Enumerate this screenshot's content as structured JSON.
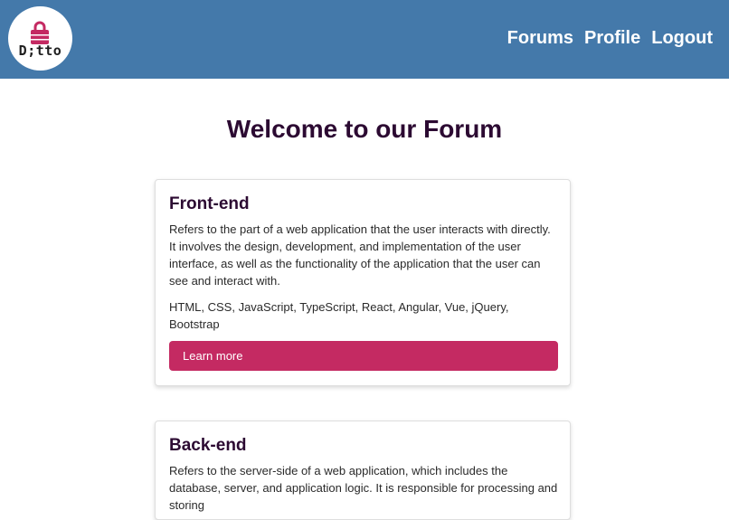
{
  "header": {
    "logo_text": "D;tto",
    "nav": [
      {
        "label": "Forums"
      },
      {
        "label": "Profile"
      },
      {
        "label": "Logout"
      }
    ],
    "colors": {
      "bar": "#4479aa",
      "logo_lock": "#c42a62"
    }
  },
  "main": {
    "title": "Welcome to our Forum",
    "cards": [
      {
        "title": "Front-end",
        "description": "Refers to the part of a web application that the user interacts with directly. It involves the design, development, and implementation of the user interface, as well as the functionality of the application that the user can see and interact with.",
        "technologies": "HTML, CSS, JavaScript, TypeScript, React, Angular, Vue, jQuery, Bootstrap",
        "button_label": "Learn more"
      },
      {
        "title": "Back-end",
        "description": "Refers to the server-side of a web application, which includes the database, server, and application logic. It is responsible for processing and storing"
      }
    ],
    "colors": {
      "title": "#2c0a32",
      "button": "#c42a62"
    }
  }
}
